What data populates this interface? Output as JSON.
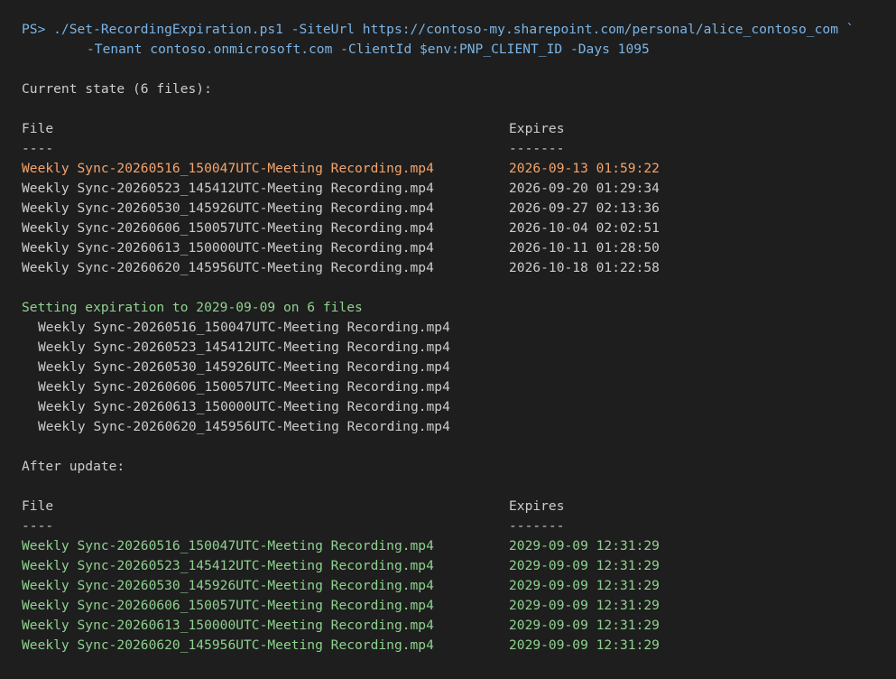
{
  "command": {
    "line1": "PS> ./Set-RecordingExpiration.ps1 -SiteUrl https://contoso-my.sharepoint.com/personal/alice_contoso_com `",
    "line2": "-Tenant contoso.onmicrosoft.com -ClientId $env:PNP_CLIENT_ID -Days 1095"
  },
  "current": {
    "heading": "Current state (6 files):",
    "col_file": "File",
    "col_expires": "Expires",
    "sep_file": "----",
    "sep_expires": "-------",
    "rows": [
      {
        "file": "Weekly Sync-20260516_150047UTC-Meeting Recording.mp4",
        "expires": "2026-09-13 01:59:22"
      },
      {
        "file": "Weekly Sync-20260523_145412UTC-Meeting Recording.mp4",
        "expires": "2026-09-20 01:29:34"
      },
      {
        "file": "Weekly Sync-20260530_145926UTC-Meeting Recording.mp4",
        "expires": "2026-09-27 02:13:36"
      },
      {
        "file": "Weekly Sync-20260606_150057UTC-Meeting Recording.mp4",
        "expires": "2026-10-04 02:02:51"
      },
      {
        "file": "Weekly Sync-20260613_150000UTC-Meeting Recording.mp4",
        "expires": "2026-10-11 01:28:50"
      },
      {
        "file": "Weekly Sync-20260620_145956UTC-Meeting Recording.mp4",
        "expires": "2026-10-18 01:22:58"
      }
    ]
  },
  "setting": {
    "heading": "Setting expiration to 2029-09-09 on 6 files",
    "files": [
      "Weekly Sync-20260516_150047UTC-Meeting Recording.mp4",
      "Weekly Sync-20260523_145412UTC-Meeting Recording.mp4",
      "Weekly Sync-20260530_145926UTC-Meeting Recording.mp4",
      "Weekly Sync-20260606_150057UTC-Meeting Recording.mp4",
      "Weekly Sync-20260613_150000UTC-Meeting Recording.mp4",
      "Weekly Sync-20260620_145956UTC-Meeting Recording.mp4"
    ]
  },
  "after": {
    "heading": "After update:",
    "col_file": "File",
    "col_expires": "Expires",
    "sep_file": "----",
    "sep_expires": "-------",
    "rows": [
      {
        "file": "Weekly Sync-20260516_150047UTC-Meeting Recording.mp4",
        "expires": "2029-09-09 12:31:29"
      },
      {
        "file": "Weekly Sync-20260523_145412UTC-Meeting Recording.mp4",
        "expires": "2029-09-09 12:31:29"
      },
      {
        "file": "Weekly Sync-20260530_145926UTC-Meeting Recording.mp4",
        "expires": "2029-09-09 12:31:29"
      },
      {
        "file": "Weekly Sync-20260606_150057UTC-Meeting Recording.mp4",
        "expires": "2029-09-09 12:31:29"
      },
      {
        "file": "Weekly Sync-20260613_150000UTC-Meeting Recording.mp4",
        "expires": "2029-09-09 12:31:29"
      },
      {
        "file": "Weekly Sync-20260620_145956UTC-Meeting Recording.mp4",
        "expires": "2029-09-09 12:31:29"
      }
    ]
  },
  "colors": {
    "background": "#1e1e1e",
    "text": "#cccccc",
    "command": "#7ab4e6",
    "warning": "#f5a46b",
    "success": "#8fd18f"
  }
}
